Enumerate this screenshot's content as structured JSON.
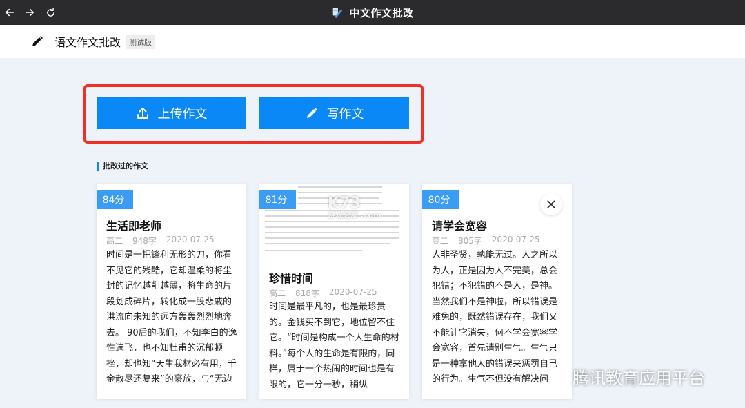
{
  "window": {
    "title": "中文作文批改"
  },
  "header": {
    "app_name": "语文作文批改",
    "badge": "测试版"
  },
  "actions": {
    "upload_label": "上传作文",
    "write_label": "写作文"
  },
  "section": {
    "title": "批改过的作文"
  },
  "essays": [
    {
      "score": "84分",
      "title": "生活即老师",
      "grade": "高二",
      "words": "948字",
      "date": "2020-07-25",
      "excerpt": "时间是一把锋利无形的刀，你看不见它的残酷，它却温柔的将尘封的记忆越削越薄，将生命的片段划成碎片，转化成一股悲戚的洪流向未知的远方轰轰烈烈地奔去。 90后的我们，不知李白的逸性遄飞，也不知杜甫的沉郁顿挫，却也知“天生我材必有用，千金散尽还复来”的豪放，与“无边落木萧萧下，不尽长江滚滚"
    },
    {
      "score": "81分",
      "title": "珍惜时间",
      "grade": "高二",
      "words": "818字",
      "date": "2020-07-25",
      "excerpt": "时间是最平凡的，也是最珍贵的。金钱买不到它，地位留不住它。“时间是构成一个人生命的材料。”每个人的生命是有限的，同样，属于一个热闹的时间也是有限的，它一分一秒，稍纵"
    },
    {
      "score": "80分",
      "title": "请学会宽容",
      "grade": "高二",
      "words": "805字",
      "date": "2020-07-25",
      "excerpt": "人非圣贤，孰能无过。人之所以为人，正是因为人不完美，总会犯错；不犯错的不是人，是神。当然我们不是神啦，所以错误是难免的，既然错误存在，我们又不能让它消失，何不学会宽容学会宽容，首先请别生气。生气只是一种拿他人的错误来惩罚自己的行为。生气不但没有解决问题，同时我们也没有使他人认识"
    }
  ],
  "watermarks": {
    "k73": "K73",
    "k73_sub": "游戏之家 .com",
    "brand": "腾讯教育应用平台"
  },
  "colors": {
    "accent": "#0a88f5",
    "highlight": "#f03025",
    "titlebar": "#2b2b2d",
    "score_badge": "#3a9cf3"
  }
}
